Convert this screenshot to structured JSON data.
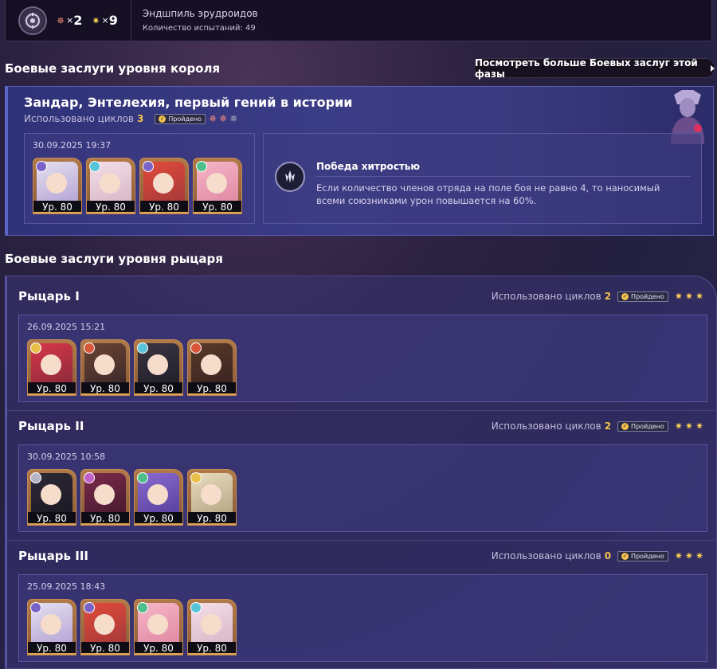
{
  "topbar": {
    "stat1": {
      "icon": "pink-star-icon",
      "mult": "×",
      "value": "2"
    },
    "stat2": {
      "icon": "gold-star-icon",
      "mult": "×",
      "value": "9"
    },
    "title": "Эндшпиль эрудроидов",
    "attempts": "Количество испытаний: 49"
  },
  "king": {
    "section_title": "Боевые заслуги уровня короля",
    "more_button": "Посмотреть больше Боевых заслуг этой фазы",
    "title": "Зандар, Энтелехия, первый гений в истории",
    "cycles_label": "Использовано циклов",
    "cycles_value": "3",
    "badge": "Пройдено",
    "date": "30.09.2025 19:37",
    "levels": [
      "Ур. 80",
      "Ур. 80",
      "Ур. 80",
      "Ур. 80"
    ],
    "buff_title": "Победа хитростью",
    "buff_desc": "Если количество членов отряда на поле боя не равно 4, то наносимый всеми союзниками урон повышается на 60%."
  },
  "knight": {
    "section_title": "Боевые заслуги уровня рыцаря",
    "rows": [
      {
        "title": "Рыцарь I",
        "cycles_label": "Использовано циклов",
        "cycles_value": "2",
        "badge": "Пройдено",
        "date": "26.09.2025 15:21",
        "levels": [
          "Ур. 80",
          "Ур. 80",
          "Ур. 80",
          "Ур. 80"
        ]
      },
      {
        "title": "Рыцарь II",
        "cycles_label": "Использовано циклов",
        "cycles_value": "2",
        "badge": "Пройдено",
        "date": "30.09.2025 10:58",
        "levels": [
          "Ур. 80",
          "Ур. 80",
          "Ур. 80",
          "Ур. 80"
        ]
      },
      {
        "title": "Рыцарь III",
        "cycles_label": "Использовано циклов",
        "cycles_value": "0",
        "badge": "Пройдено",
        "date": "25.09.2025 18:43",
        "levels": [
          "Ур. 80",
          "Ур. 80",
          "Ур. 80",
          "Ур. 80"
        ]
      }
    ]
  },
  "colors": {
    "accent_gold": "#f2c14e",
    "pink_star": "#f08a7a",
    "panel_blue": "#3b3c86"
  }
}
